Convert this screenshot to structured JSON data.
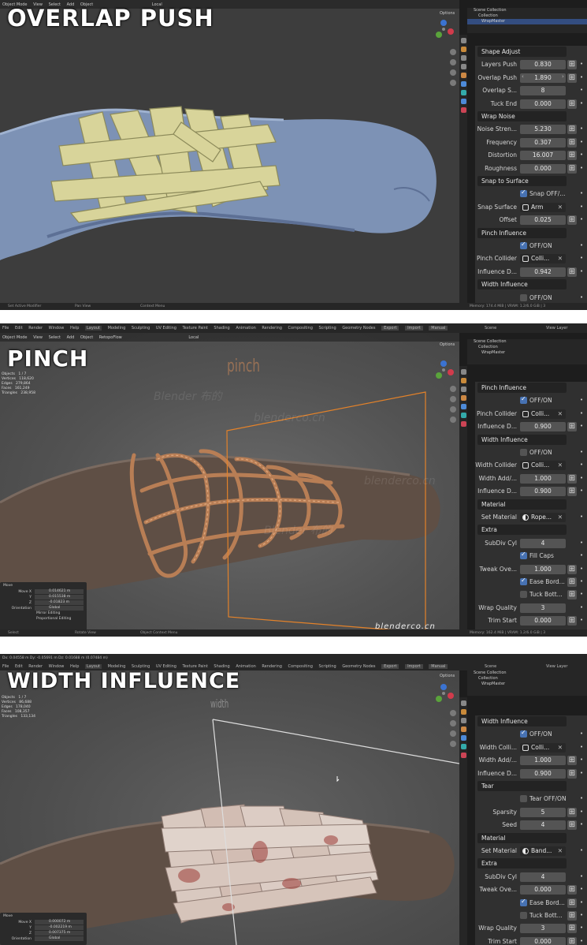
{
  "panels": [
    {
      "title": "OVERLAP PUSH",
      "viewport_header": {
        "mode": "Object Mode",
        "menus": [
          "View",
          "Select",
          "Add",
          "Object"
        ],
        "orientation": "Local",
        "options": "Options"
      },
      "outliner": {
        "items": [
          "Scene Collection",
          "Collection",
          "WrapMaster"
        ]
      },
      "properties": [
        {
          "type": "header",
          "label": "Shape Adjust"
        },
        {
          "type": "number",
          "label": "Layers Push",
          "value": "0.830",
          "btn": true
        },
        {
          "type": "number",
          "label": "Overlap Push",
          "value": "1.890",
          "btn": true,
          "arrows": true
        },
        {
          "type": "number",
          "label": "Overlap S...",
          "value": "8"
        },
        {
          "type": "number",
          "label": "Tuck End",
          "value": "0.000",
          "btn": true
        },
        {
          "type": "header",
          "label": "Wrap Noise"
        },
        {
          "type": "number",
          "label": "Noise Stren...",
          "value": "5.230",
          "btn": true
        },
        {
          "type": "number",
          "label": "Frequency",
          "value": "0.307",
          "btn": true
        },
        {
          "type": "number",
          "label": "Distortion",
          "value": "16.007",
          "btn": true
        },
        {
          "type": "number",
          "label": "Roughness",
          "value": "0.000",
          "btn": true
        },
        {
          "type": "header",
          "label": "Snap to Surface"
        },
        {
          "type": "check",
          "label": "Snap OFF/...",
          "checked": true
        },
        {
          "type": "select",
          "label": "Snap Surface",
          "value": "Arm",
          "icon": "square"
        },
        {
          "type": "number",
          "label": "Offset",
          "value": "0.025",
          "btn": true
        },
        {
          "type": "header",
          "label": "Pinch Influence"
        },
        {
          "type": "check",
          "label": "OFF/ON",
          "checked": true
        },
        {
          "type": "select",
          "label": "Pinch Collider",
          "value": "Colli...",
          "icon": "square"
        },
        {
          "type": "number",
          "label": "Influence D...",
          "value": "0.942",
          "btn": true
        },
        {
          "type": "header",
          "label": "Width Influence"
        },
        {
          "type": "check",
          "label": "OFF/ON",
          "checked": false
        }
      ],
      "status": [
        "Set Active Modifier",
        "Pan View",
        "Context Menu",
        "Memory: 174.4 MiB | VRAM: 1.2/6.0 GiB | 3"
      ]
    },
    {
      "title": "PINCH",
      "top_menus": [
        "File",
        "Edit",
        "Render",
        "Window",
        "Help",
        "Layout",
        "Modeling",
        "Sculpting",
        "UV Editing",
        "Texture Paint",
        "Shading",
        "Animation",
        "Rendering",
        "Compositing",
        "Scripting",
        "Geometry Nodes",
        "Export",
        "Import",
        "Manual"
      ],
      "viewport_header": {
        "mode": "Object Mode",
        "menus": [
          "View",
          "Select",
          "Add",
          "Object",
          "RetopoFlow"
        ],
        "orientation": "Local",
        "options": "Options"
      },
      "scene": "Scene",
      "view_layer": "View Layer",
      "viewport_label": "pinch",
      "watermark": "blenderco.cn",
      "watermarks_faint": [
        "Blender 布的",
        "blenderco.cn",
        "Blender 布的",
        "blenderco.cn"
      ],
      "stats": [
        [
          "Objects",
          "1 / 7"
        ],
        [
          "Vertices",
          "118,620"
        ],
        [
          "Edges",
          "279,864"
        ],
        [
          "Faces",
          "161,249"
        ],
        [
          "Triangles",
          "238,958"
        ]
      ],
      "move_panel": {
        "title": "Move",
        "rows": [
          [
            "Move X",
            "0.014621 m"
          ],
          [
            "Y",
            "0.015538 m"
          ],
          [
            "Z",
            "-0.01823 m"
          ]
        ],
        "orientation_label": "Orientation",
        "orientation": "Global",
        "options": [
          "Mirror Editing",
          "Proportional Editing"
        ]
      },
      "outliner": {
        "items": [
          "Scene Collection",
          "Collection",
          "WrapMaster"
        ]
      },
      "properties": [
        {
          "type": "header",
          "label": "Pinch Influence"
        },
        {
          "type": "check",
          "label": "OFF/ON",
          "checked": true
        },
        {
          "type": "select",
          "label": "Pinch Collider",
          "value": "Colli...",
          "icon": "square"
        },
        {
          "type": "number",
          "label": "Influence D...",
          "value": "0.900",
          "btn": true
        },
        {
          "type": "header",
          "label": "Width Influence"
        },
        {
          "type": "check",
          "label": "OFF/ON",
          "checked": false
        },
        {
          "type": "select",
          "label": "Width Collider",
          "value": "Colli...",
          "icon": "square"
        },
        {
          "type": "number",
          "label": "Width Add/...",
          "value": "1.000",
          "btn": true
        },
        {
          "type": "number",
          "label": "Influence D...",
          "value": "0.900",
          "btn": true
        },
        {
          "type": "header",
          "label": "Material"
        },
        {
          "type": "select",
          "label": "Set Material",
          "value": "Rope...",
          "icon": "ball"
        },
        {
          "type": "header",
          "label": "Extra"
        },
        {
          "type": "number",
          "label": "SubDiv Cyl",
          "value": "4"
        },
        {
          "type": "check",
          "label": "Fill Caps",
          "checked": true
        },
        {
          "type": "number",
          "label": "Tweak Ove...",
          "value": "1.000",
          "btn": true
        },
        {
          "type": "check",
          "label": "Ease Bord...",
          "checked": true,
          "btn": true
        },
        {
          "type": "check",
          "label": "Tuck Bott...",
          "checked": false,
          "btn": true
        },
        {
          "type": "number",
          "label": "Wrap Quality",
          "value": "3"
        },
        {
          "type": "number",
          "label": "Trim Start",
          "value": "0.000",
          "btn": true
        }
      ],
      "status": [
        "Select",
        "Rotate View",
        "Object Context Menu",
        "Memory: 162.4 MiB | VRAM: 1.2/6.0 GiB | 3"
      ]
    },
    {
      "title": "WIDTH INFLUENCE",
      "delta_readout": "Dx: 0.04558 m   Dy: -0.05691 m   Dz: 0.01688 m (0.07484 m)",
      "top_menus": [
        "File",
        "Edit",
        "Render",
        "Window",
        "Help",
        "Layout",
        "Modeling",
        "Sculpting",
        "UV Editing",
        "Texture Paint",
        "Shading",
        "Animation",
        "Rendering",
        "Compositing",
        "Scripting",
        "Geometry Nodes",
        "Export",
        "Import",
        "Manual"
      ],
      "scene": "Scene",
      "view_layer": "View Layer",
      "viewport_label": "width",
      "options": "Options",
      "stats": [
        [
          "Objects",
          "1 / 7"
        ],
        [
          "Vertices",
          "86,688"
        ],
        [
          "Edges",
          "178,040"
        ],
        [
          "Faces",
          "108,357"
        ],
        [
          "Triangles",
          "133,134"
        ]
      ],
      "move_panel": {
        "title": "Move",
        "rows": [
          [
            "Move X",
            "0.000072 m"
          ],
          [
            "Y",
            "-0.002219 m"
          ],
          [
            "Z",
            "0.007375 m"
          ]
        ],
        "orientation_label": "Orientation",
        "orientation": "Global"
      },
      "outliner": {
        "items": [
          "Scene Collection",
          "Collection",
          "WrapMaster"
        ]
      },
      "properties": [
        {
          "type": "header",
          "label": "Width Influence"
        },
        {
          "type": "check",
          "label": "OFF/ON",
          "checked": true
        },
        {
          "type": "select",
          "label": "Width Colli...",
          "value": "Colli...",
          "icon": "square"
        },
        {
          "type": "number",
          "label": "Width Add/...",
          "value": "1.000",
          "btn": true
        },
        {
          "type": "number",
          "label": "Influence D...",
          "value": "0.900",
          "btn": true
        },
        {
          "type": "header",
          "label": "Tear"
        },
        {
          "type": "check",
          "label": "Tear OFF/ON",
          "checked": false
        },
        {
          "type": "number",
          "label": "Sparsity",
          "value": "5",
          "btn": true
        },
        {
          "type": "number",
          "label": "Seed",
          "value": "4",
          "btn": true
        },
        {
          "type": "header",
          "label": "Material"
        },
        {
          "type": "select",
          "label": "Set Material",
          "value": "Band...",
          "icon": "ball"
        },
        {
          "type": "header",
          "label": "Extra"
        },
        {
          "type": "number",
          "label": "SubDiv Cyl",
          "value": "4"
        },
        {
          "type": "number",
          "label": "Tweak Ove...",
          "value": "0.000",
          "btn": true
        },
        {
          "type": "check",
          "label": "Ease Bord...",
          "checked": true,
          "btn": true
        },
        {
          "type": "check",
          "label": "Tuck Bott...",
          "checked": false,
          "btn": true
        },
        {
          "type": "number",
          "label": "Wrap Quality",
          "value": "3",
          "btn": true
        },
        {
          "type": "number",
          "label": "Trim Start",
          "value": "0.000",
          "btn": true
        }
      ]
    }
  ],
  "colors": {
    "accent": "#4772b3",
    "wrap_yellow": "#d8d49a",
    "arm_blue": "#7d92b5",
    "rope": "#b87e55",
    "bandage": "#d9c9c0",
    "blood": "#9c3a35",
    "skin": "#5f4f45"
  }
}
